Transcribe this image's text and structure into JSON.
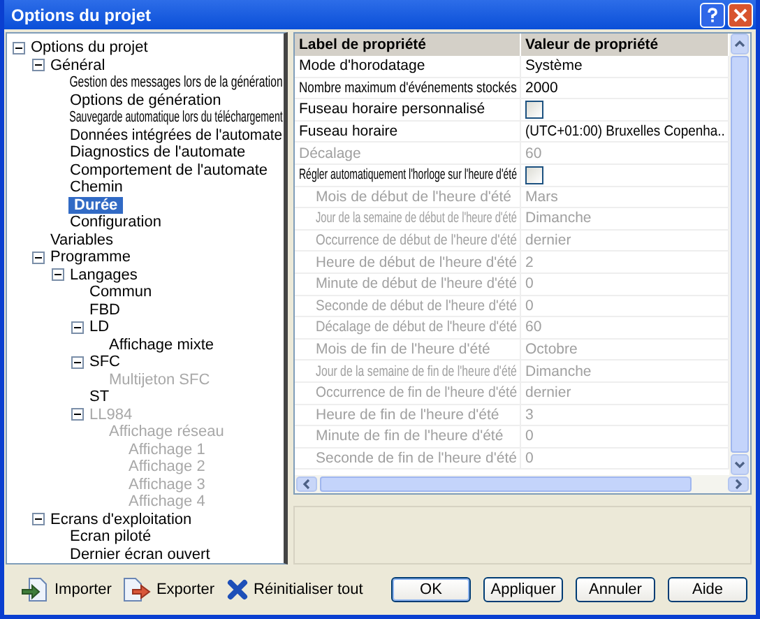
{
  "window": {
    "title": "Options du projet"
  },
  "tree": [
    {
      "label": "Options du projet",
      "expanded": true,
      "disabled": false,
      "selected": false,
      "children": [
        {
          "label": "Général",
          "expanded": true,
          "disabled": false,
          "selected": false,
          "children": [
            {
              "label": "Gestion des messages lors de la génération",
              "disabled": false,
              "selected": false
            },
            {
              "label": "Options de génération",
              "disabled": false,
              "selected": false
            },
            {
              "label": "Sauvegarde automatique lors du téléchargement",
              "disabled": false,
              "selected": false
            },
            {
              "label": "Données intégrées de l'automate",
              "disabled": false,
              "selected": false
            },
            {
              "label": "Diagnostics de l'automate",
              "disabled": false,
              "selected": false
            },
            {
              "label": "Comportement de l'automate",
              "disabled": false,
              "selected": false
            },
            {
              "label": "Chemin",
              "disabled": false,
              "selected": false
            },
            {
              "label": "Durée",
              "disabled": false,
              "selected": true
            },
            {
              "label": "Configuration",
              "disabled": false,
              "selected": false
            }
          ]
        },
        {
          "label": "Variables",
          "disabled": false,
          "selected": false
        },
        {
          "label": "Programme",
          "expanded": true,
          "disabled": false,
          "selected": false,
          "children": [
            {
              "label": "Langages",
              "expanded": true,
              "disabled": false,
              "selected": false,
              "children": [
                {
                  "label": "Commun",
                  "disabled": false,
                  "selected": false
                },
                {
                  "label": "FBD",
                  "disabled": false,
                  "selected": false
                },
                {
                  "label": "LD",
                  "expanded": true,
                  "disabled": false,
                  "selected": false,
                  "children": [
                    {
                      "label": "Affichage mixte",
                      "disabled": false,
                      "selected": false
                    }
                  ]
                },
                {
                  "label": "SFC",
                  "expanded": true,
                  "disabled": false,
                  "selected": false,
                  "children": [
                    {
                      "label": "Multijeton SFC",
                      "disabled": true,
                      "selected": false
                    }
                  ]
                },
                {
                  "label": "ST",
                  "disabled": false,
                  "selected": false
                },
                {
                  "label": "LL984",
                  "expanded": true,
                  "disabled": true,
                  "selected": false,
                  "children": [
                    {
                      "label": "Affichage réseau",
                      "disabled": true,
                      "selected": false,
                      "children": [
                        {
                          "label": "Affichage 1",
                          "disabled": true,
                          "selected": false
                        },
                        {
                          "label": "Affichage 2",
                          "disabled": true,
                          "selected": false
                        },
                        {
                          "label": "Affichage 3",
                          "disabled": true,
                          "selected": false
                        },
                        {
                          "label": "Affichage 4",
                          "disabled": true,
                          "selected": false
                        }
                      ]
                    }
                  ]
                }
              ]
            }
          ]
        },
        {
          "label": "Ecrans d'exploitation",
          "expanded": true,
          "disabled": false,
          "selected": false,
          "children": [
            {
              "label": "Ecran piloté",
              "disabled": false,
              "selected": false
            },
            {
              "label": "Dernier écran ouvert",
              "disabled": false,
              "selected": false
            }
          ]
        }
      ]
    }
  ],
  "grid": {
    "columns": [
      "Label de propriété",
      "Valeur de propriété"
    ],
    "rows": [
      {
        "label": "Mode d'horodatage",
        "kind": "text",
        "value": "Système",
        "disabled": false
      },
      {
        "label": "Nombre maximum d'événements stockés",
        "kind": "text",
        "value": "2000",
        "disabled": false
      },
      {
        "label": "Fuseau horaire personnalisé",
        "kind": "checkbox",
        "checked": false,
        "disabled": false
      },
      {
        "label": "Fuseau horaire",
        "kind": "text",
        "value": "(UTC+01:00) Bruxelles Copenha..",
        "disabled": false
      },
      {
        "label": "Décalage",
        "kind": "text",
        "value": "60",
        "disabled": true
      },
      {
        "label": "Régler automatiquement l'horloge sur l'heure d'été",
        "kind": "checkbox",
        "checked": false,
        "disabled": false,
        "children": [
          {
            "label": "Mois de début de l'heure d'été",
            "kind": "text",
            "value": "Mars",
            "disabled": true
          },
          {
            "label": "Jour de la semaine de début de l'heure d'été",
            "kind": "text",
            "value": "Dimanche",
            "disabled": true
          },
          {
            "label": "Occurrence de début de l'heure d'été",
            "kind": "text",
            "value": "dernier",
            "disabled": true
          },
          {
            "label": "Heure de début de l'heure d'été",
            "kind": "text",
            "value": "2",
            "disabled": true
          },
          {
            "label": "Minute de début de l'heure d'été",
            "kind": "text",
            "value": "0",
            "disabled": true
          },
          {
            "label": "Seconde de début de l'heure d'été",
            "kind": "text",
            "value": "0",
            "disabled": true
          },
          {
            "label": "Décalage de début de l'heure d'été",
            "kind": "text",
            "value": "60",
            "disabled": true
          },
          {
            "label": "Mois de fin de l'heure d'été",
            "kind": "text",
            "value": "Octobre",
            "disabled": true
          },
          {
            "label": "Jour de la semaine de fin de l'heure d'été",
            "kind": "text",
            "value": "Dimanche",
            "disabled": true
          },
          {
            "label": "Occurrence de fin de l'heure d'été",
            "kind": "text",
            "value": "dernier",
            "disabled": true
          },
          {
            "label": "Heure de fin de l'heure d'été",
            "kind": "text",
            "value": "3",
            "disabled": true
          },
          {
            "label": "Minute de fin de l'heure d'été",
            "kind": "text",
            "value": "0",
            "disabled": true
          },
          {
            "label": "Seconde de fin de l'heure d'été",
            "kind": "text",
            "value": "0",
            "disabled": true
          }
        ]
      }
    ]
  },
  "tools": [
    {
      "label": "Importer",
      "kind": "import"
    },
    {
      "label": "Exporter",
      "kind": "export"
    },
    {
      "label": "Réinitialiser tout",
      "kind": "reset"
    }
  ],
  "buttons": [
    "OK",
    "Appliquer",
    "Annuler",
    "Aide"
  ]
}
